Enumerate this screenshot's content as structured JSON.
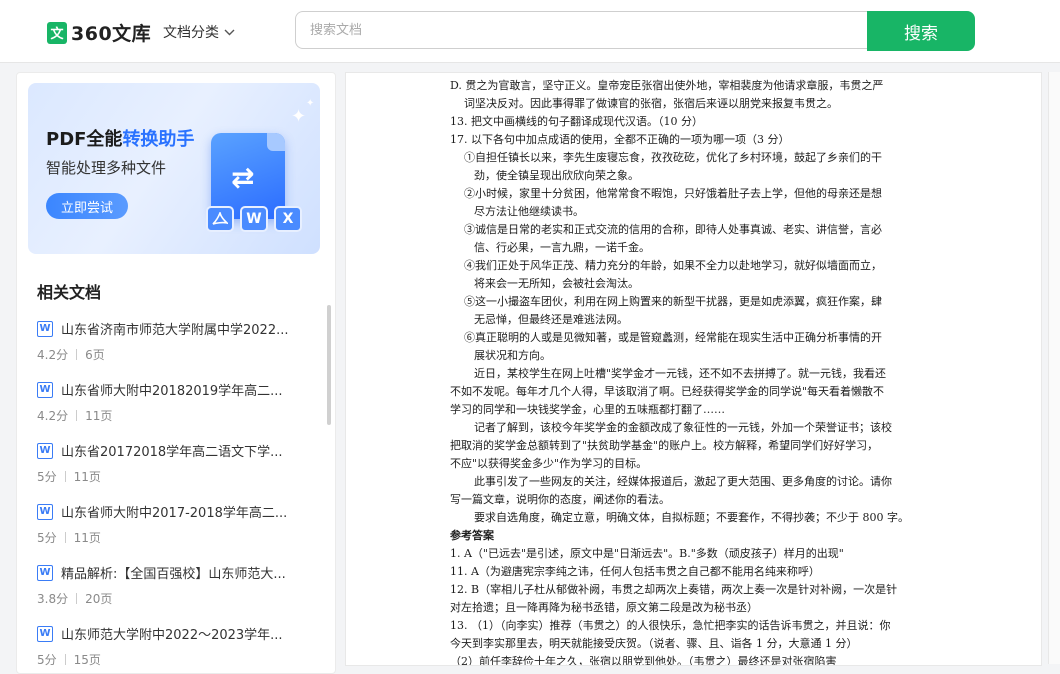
{
  "header": {
    "logo_mark": "文",
    "logo_text": "360文库",
    "category_label": "文档分类",
    "search_placeholder": "搜索文档",
    "search_button": "搜索"
  },
  "banner": {
    "title_plain": "PDF全能",
    "title_highlight": "转换助手",
    "subtitle": "智能处理多种文件",
    "cta": "立即尝试",
    "badges": [
      "W",
      "X"
    ]
  },
  "sidebar": {
    "section_title": "相关文档",
    "docs": [
      {
        "title": "山东省济南市师范大学附属中学2022...",
        "score": "4.2分",
        "pages": "6页"
      },
      {
        "title": "山东省师大附中20182019学年高二...",
        "score": "4.2分",
        "pages": "11页"
      },
      {
        "title": "山东省20172018学年高二语文下学...",
        "score": "5分",
        "pages": "11页"
      },
      {
        "title": "山东省师大附中2017-2018学年高二...",
        "score": "5分",
        "pages": "11页"
      },
      {
        "title": "精品解析:【全国百强校】山东师范大...",
        "score": "3.8分",
        "pages": "20页"
      },
      {
        "title": "山东师范大学附中2022～2023学年...",
        "score": "5分",
        "pages": "15页"
      }
    ]
  },
  "document": {
    "lines": [
      {
        "text": "D. 贯之为官敢言，坚守正义。皇帝宠臣张宿出使外地，宰相裴度为他请求章服，韦贯之严",
        "cls": ""
      },
      {
        "text": "词坚决反对。因此事得罪了做谏官的张宿，张宿后来诬以朋党来报复韦贯之。",
        "cls": "ind1"
      },
      {
        "text": "13. 把文中画横线的句子翻译成现代汉语。（10 分）",
        "cls": ""
      },
      {
        "text": "17. 以下各句中加点成语的使用，全都不正确的一项为哪一项（3 分）",
        "cls": ""
      },
      {
        "text": "①自担任镇长以来，李先生废寝忘食，孜孜矻矻，优化了乡村环境，鼓起了乡亲们的干",
        "cls": "ind1"
      },
      {
        "text": "劲，使全镇呈现出欣欣向荣之象。",
        "cls": "ind2"
      },
      {
        "text": "②小时候，家里十分贫困，他常常食不暇饱，只好饿着肚子去上学，但他的母亲还是想",
        "cls": "ind1"
      },
      {
        "text": "尽方法让他继续读书。",
        "cls": "ind2"
      },
      {
        "text": "③诚信是日常的老实和正式交流的信用的合称，即待人处事真诚、老实、讲信誉，言必",
        "cls": "ind1"
      },
      {
        "text": "信、行必果，一言九鼎，一诺千金。",
        "cls": "ind2"
      },
      {
        "text": "④我们正处于风华正茂、精力充分的年龄，如果不全力以赴地学习，就好似墙面而立，",
        "cls": "ind1"
      },
      {
        "text": "将来会一无所知，会被社会淘汰。",
        "cls": "ind2"
      },
      {
        "text": "⑤这一小撮盗车团伙，利用在网上购置来的新型干扰器，更是如虎添翼，疯狂作案，肆",
        "cls": "ind1"
      },
      {
        "text": "无忌惮，但最终还是难逃法网。",
        "cls": "ind2"
      },
      {
        "text": "⑥真正聪明的人或是见微知著，或是管窥蠡测，经常能在现实生活中正确分析事情的开",
        "cls": "ind1"
      },
      {
        "text": "展状况和方向。",
        "cls": "ind2"
      },
      {
        "text": "近日，某校学生在网上吐槽\"奖学金才一元钱，还不如不去拼搏了。就一元钱，我看还",
        "cls": "ind2"
      },
      {
        "text": "不如不发呢。每年才几个人得，早该取消了啊。已经获得奖学金的同学说\"每天看着懒散不",
        "cls": ""
      },
      {
        "text": "学习的同学和一块钱奖学金，心里的五味瓶都打翻了……",
        "cls": ""
      },
      {
        "text": "记者了解到，该校今年奖学金的金额改成了象征性的一元钱，外加一个荣誉证书；该校",
        "cls": "ind2"
      },
      {
        "text": "把取消的奖学金总额转到了\"扶贫助学基金\"的账户上。校方解释，希望同学们好好学习，",
        "cls": ""
      },
      {
        "text": "不应\"以获得奖金多少\"作为学习的目标。",
        "cls": ""
      },
      {
        "text": "此事引发了一些网友的关注，经媒体报道后，激起了更大范围、更多角度的讨论。请你",
        "cls": "ind2"
      },
      {
        "text": "写一篇文章，说明你的态度，阐述你的看法。",
        "cls": ""
      },
      {
        "text": "要求自选角度，确定立意，明确文体，自拟标题；不要套作，不得抄袭；不少于 800 字。",
        "cls": "ind2"
      },
      {
        "text": "参考答案",
        "cls": "bold"
      },
      {
        "text": "1. A（\"已远去\"是引述，原文中是\"日渐远去\"。B.\"多数（顽皮孩子）样月的出现\"",
        "cls": ""
      },
      {
        "text": "11. A（为避唐宪宗李纯之讳，任何人包括韦贯之自己都不能用名纯来称呼）",
        "cls": ""
      },
      {
        "text": "12. B（宰相儿子杜从郁做补阙，韦贯之却两次上奏错，两次上奏一次是针对补阙，一次是针",
        "cls": ""
      },
      {
        "text": "对左拾遗；且一降再降为秘书丞错，原文第二段是改为秘书丞）",
        "cls": ""
      },
      {
        "text": "13. （1）（向李实）推荐（韦贯之）的人很快乐，急忙把李实的话告诉韦贯之，并且说：你",
        "cls": ""
      },
      {
        "text": "今天到李实那里去，明天就能接受庆贺。（说者、骤、且、诣各 1 分，大意通 1 分）",
        "cls": ""
      },
      {
        "text": "（2）前任李辞俭十年之久，张宿以朋党到他处。（韦贯之）最终还是对张宿陷害",
        "cls": ""
      }
    ]
  }
}
